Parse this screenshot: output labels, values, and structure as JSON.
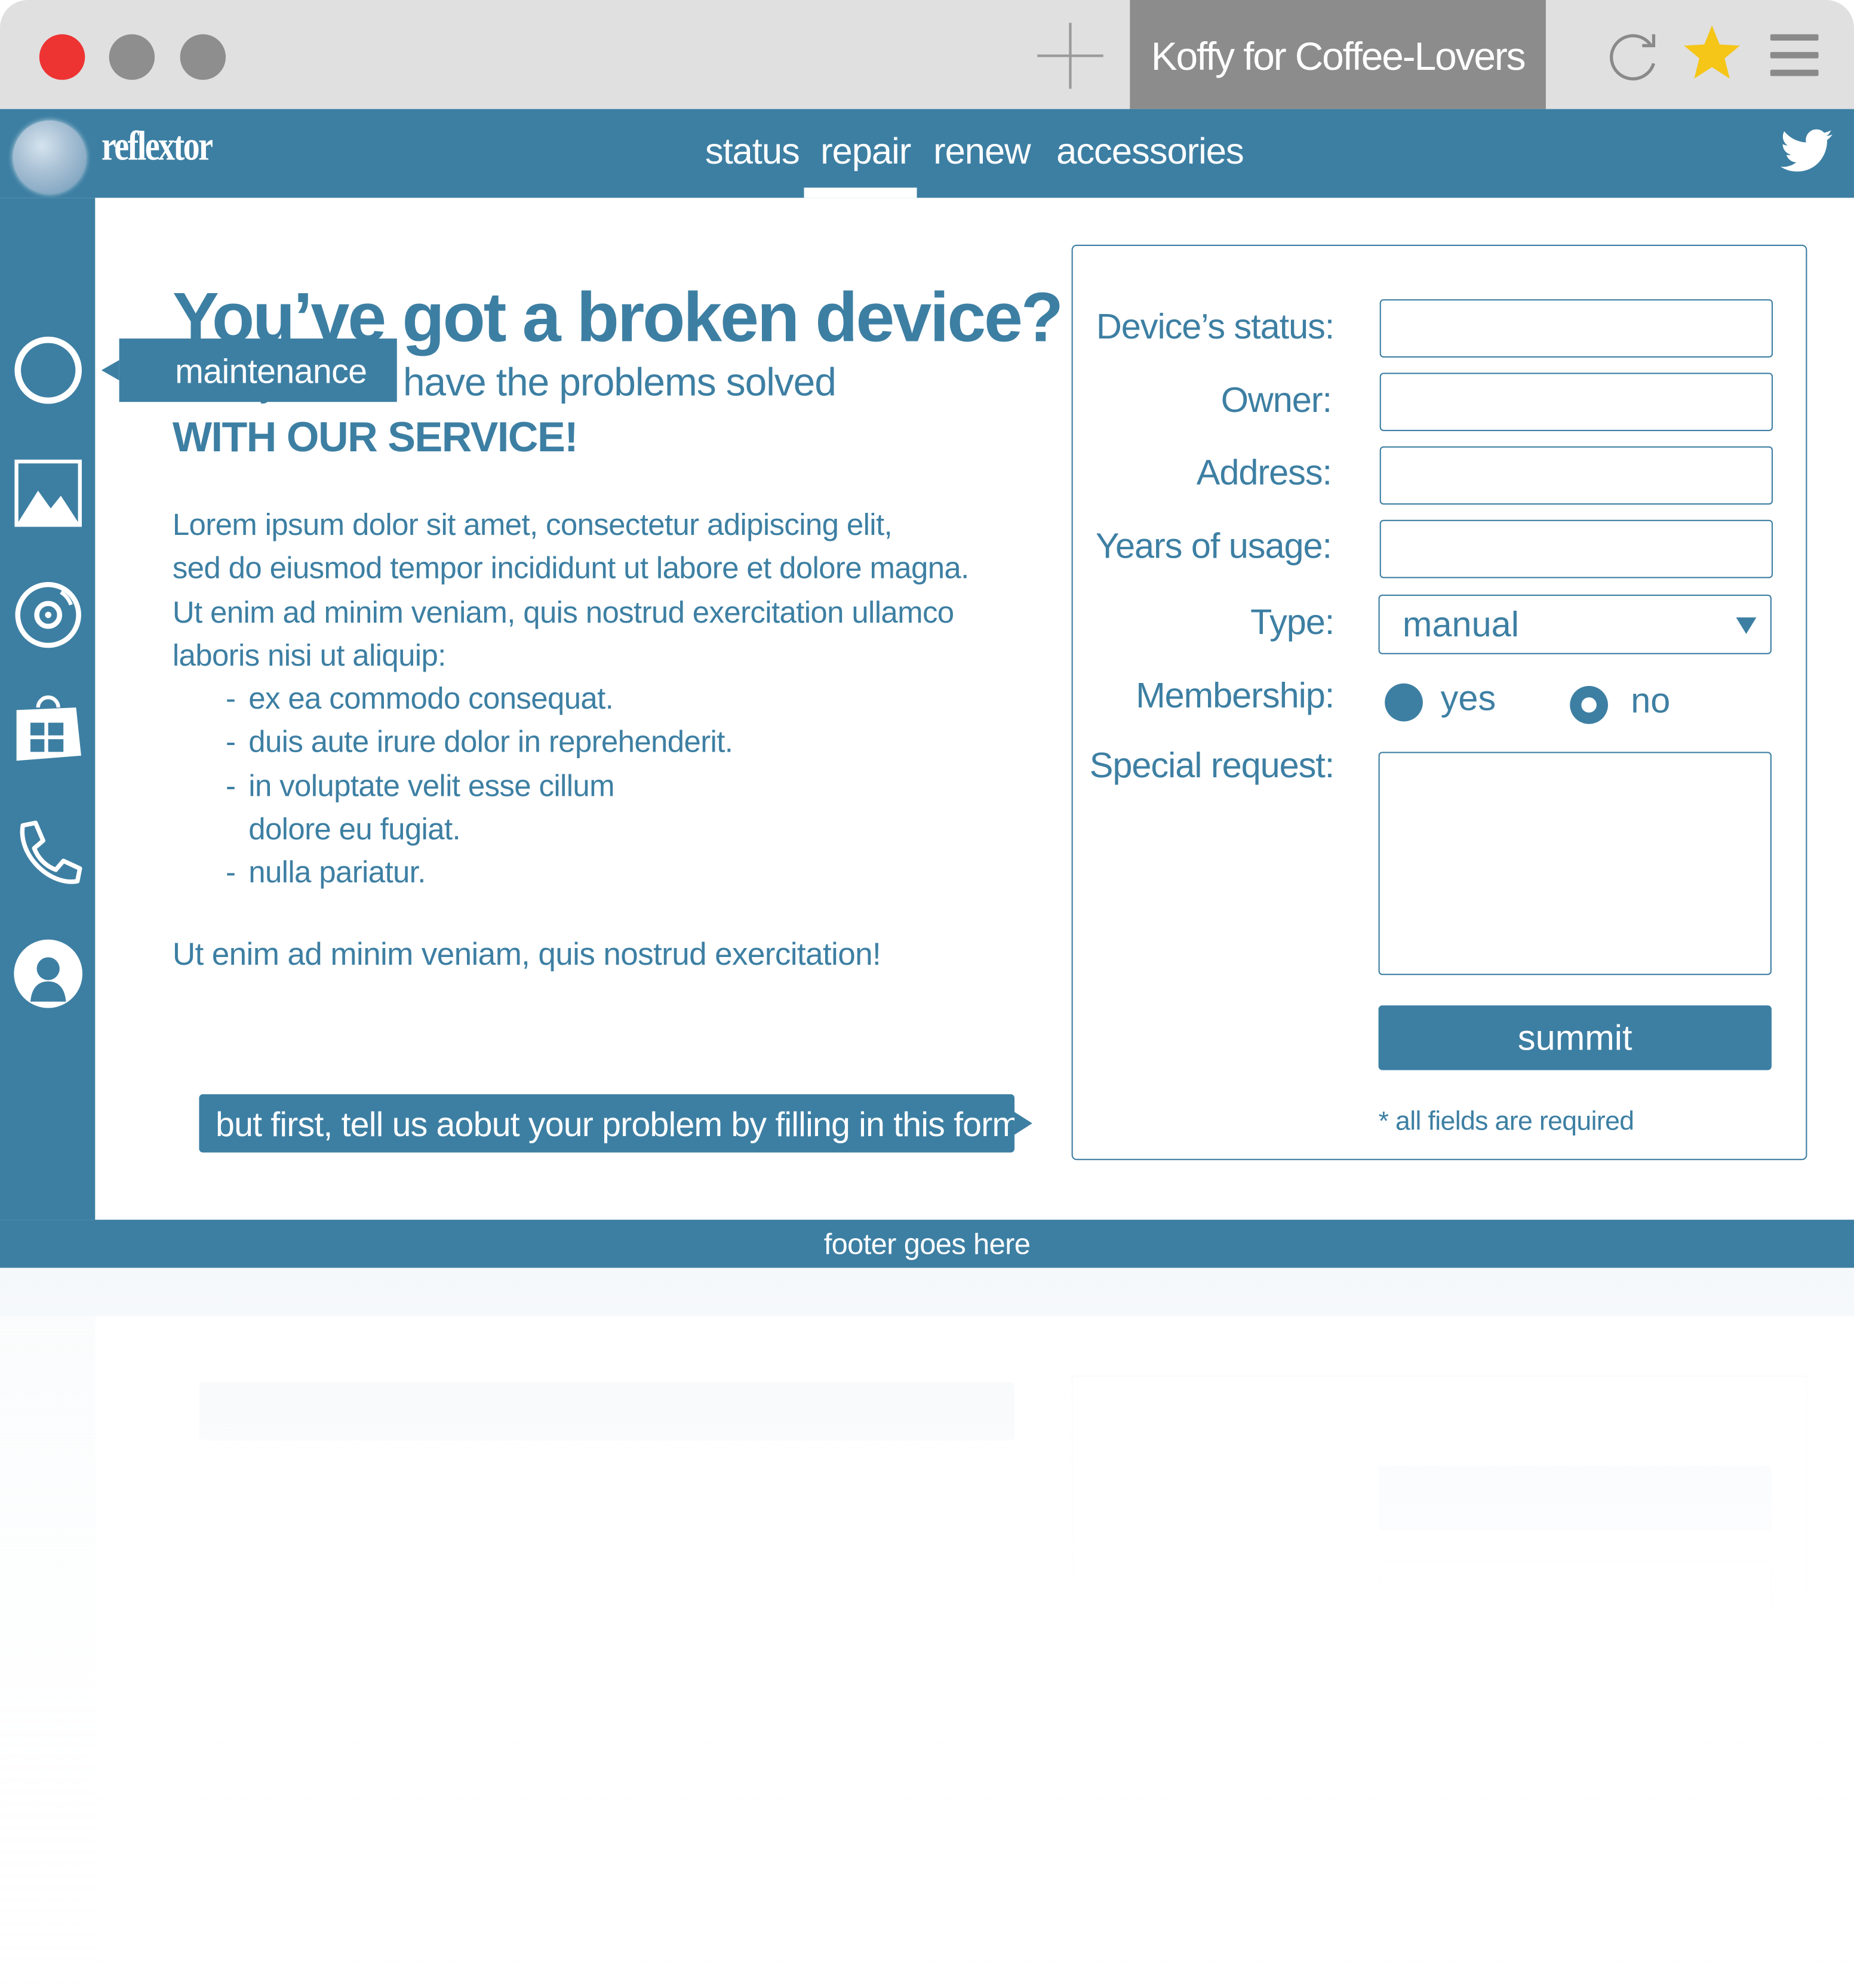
{
  "browser": {
    "tab_title": "Koffy for Coffee-Lovers"
  },
  "site": {
    "logo_text": "reflextor",
    "nav": [
      {
        "label": "status"
      },
      {
        "label": "repair"
      },
      {
        "label": "renew"
      },
      {
        "label": "accessories"
      }
    ],
    "active_nav": "repair"
  },
  "sidebar": {
    "icons": [
      "circle-icon",
      "image-icon",
      "disc-icon",
      "store-icon",
      "phone-icon",
      "user-icon"
    ],
    "tooltip": "maintenance"
  },
  "content": {
    "headline": "You’ve got a broken device?",
    "subline": "Now you can have the problems solved",
    "service_line": "WITH OUR SERVICE!",
    "paragraph_lines": [
      "Lorem ipsum dolor sit amet, consectetur adipiscing elit,",
      "sed do eiusmod tempor incididunt ut labore et dolore magna.",
      "Ut enim ad minim veniam, quis nostrud exercitation ullamco",
      "laboris nisi ut aliquip:"
    ],
    "bullets": [
      "ex ea commodo consequat.",
      "duis aute irure dolor in reprehenderit.",
      "in voluptate velit esse cillum dolore eu fugiat.",
      "nulla pariatur."
    ],
    "closing": "Ut enim ad minim veniam, quis nostrud exercitation!",
    "cta": "but first, tell us aobut your problem by filling in this form"
  },
  "form": {
    "labels": {
      "status": "Device’s status:",
      "owner": "Owner:",
      "address": "Address:",
      "years": "Years of usage:",
      "type": "Type:",
      "membership": "Membership:",
      "special": "Special request:"
    },
    "values": {
      "status": "",
      "owner": "",
      "address": "",
      "years": "",
      "type": "manual",
      "special": ""
    },
    "membership_options": {
      "yes": "yes",
      "no": "no"
    },
    "membership_selected": "no",
    "submit_label": "summit",
    "required_note": "* all fields are required"
  },
  "footer": {
    "text": "footer goes here"
  },
  "colors": {
    "brand": "#3d7fa3",
    "close_dot": "#ee3333",
    "star": "#f5c518"
  }
}
